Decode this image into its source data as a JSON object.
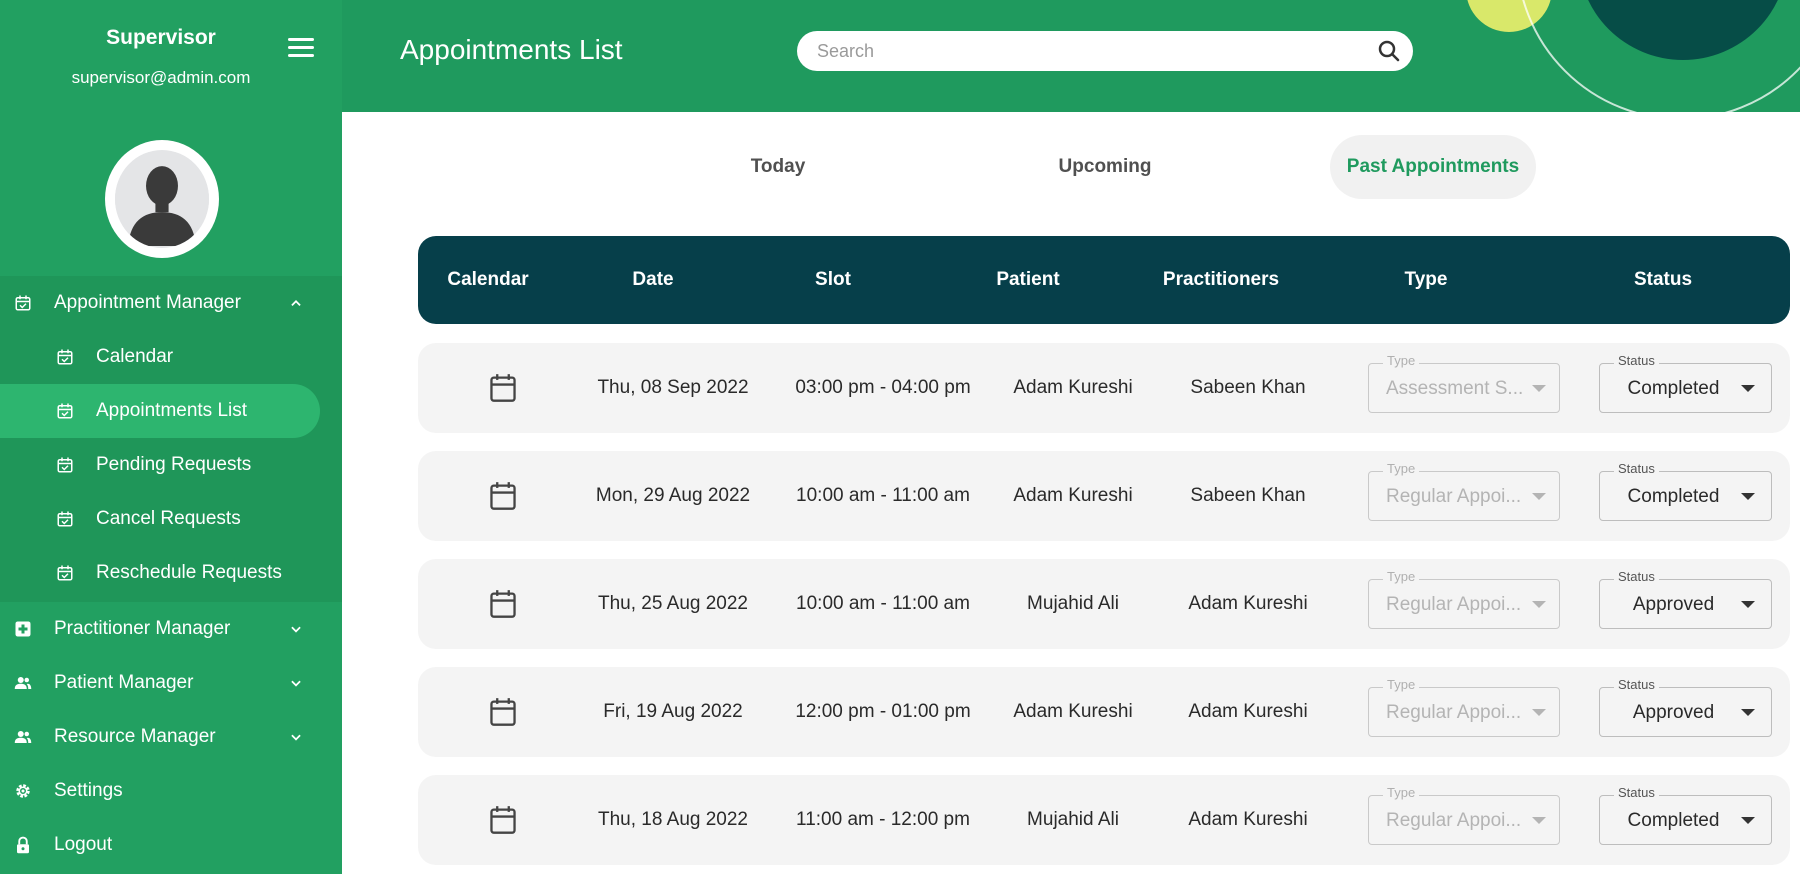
{
  "sidebar": {
    "user_name": "Supervisor",
    "user_email": "supervisor@admin.com",
    "menu": {
      "appointment_manager": "Appointment Manager",
      "calendar": "Calendar",
      "appointments_list": "Appointments List",
      "pending_requests": "Pending Requests",
      "cancel_requests": "Cancel Requests",
      "reschedule_requests": "Reschedule Requests",
      "practitioner_manager": "Practitioner Manager",
      "patient_manager": "Patient Manager",
      "resource_manager": "Resource Manager",
      "settings": "Settings",
      "logout": "Logout"
    }
  },
  "header": {
    "title": "Appointments List",
    "search_placeholder": "Search"
  },
  "tabs": {
    "today": "Today",
    "upcoming": "Upcoming",
    "past": "Past Appointments",
    "active": "past"
  },
  "table": {
    "columns": {
      "calendar": "Calendar",
      "date": "Date",
      "slot": "Slot",
      "patient": "Patient",
      "practitioners": "Practitioners",
      "type": "Type",
      "status": "Status"
    },
    "type_label": "Type",
    "status_label": "Status",
    "rows": [
      {
        "date": "Thu, 08 Sep 2022",
        "slot": "03:00 pm - 04:00 pm",
        "patient": "Adam Kureshi",
        "practitioner": "Sabeen Khan",
        "type": "Assessment S...",
        "status": "Completed"
      },
      {
        "date": "Mon, 29 Aug 2022",
        "slot": "10:00 am - 11:00 am",
        "patient": "Adam Kureshi",
        "practitioner": "Sabeen Khan",
        "type": "Regular Appoi...",
        "status": "Completed"
      },
      {
        "date": "Thu, 25 Aug 2022",
        "slot": "10:00 am - 11:00 am",
        "patient": "Mujahid Ali",
        "practitioner": "Adam Kureshi",
        "type": "Regular Appoi...",
        "status": "Approved"
      },
      {
        "date": "Fri, 19 Aug 2022",
        "slot": "12:00 pm - 01:00 pm",
        "patient": "Adam Kureshi",
        "practitioner": "Adam Kureshi",
        "type": "Regular Appoi...",
        "status": "Approved"
      },
      {
        "date": "Thu, 18 Aug 2022",
        "slot": "11:00 am - 12:00 pm",
        "patient": "Mujahid Ali",
        "practitioner": "Adam Kureshi",
        "type": "Regular Appoi...",
        "status": "Completed"
      }
    ]
  },
  "colors": {
    "sidebar_green": "#22a061",
    "header_green": "#1f9a5e",
    "table_header": "#063f4a",
    "active_tab_text": "#1f9a5e",
    "accent_yellow": "#d9e86a"
  }
}
